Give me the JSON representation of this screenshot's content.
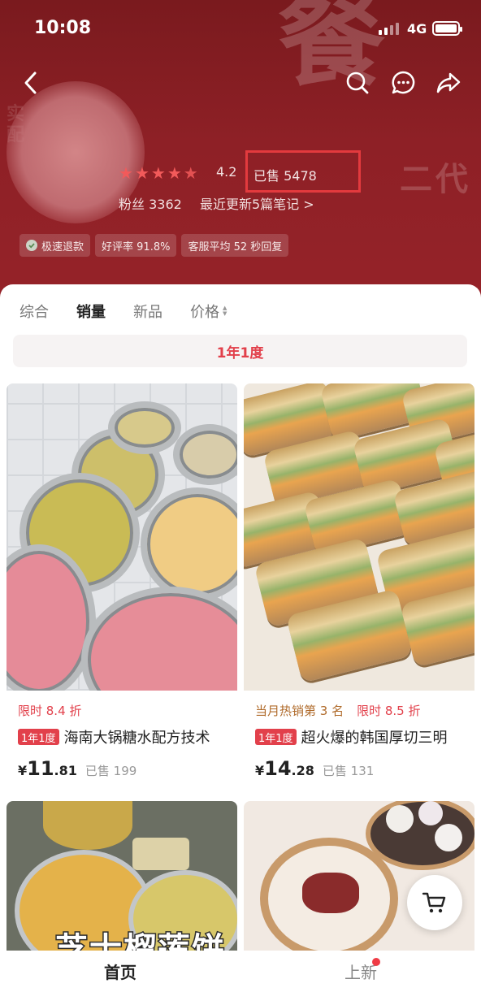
{
  "status_bar": {
    "time": "10:08",
    "network": "4G"
  },
  "header": {
    "bg_big_char": "餐",
    "bg_side_text": "二代",
    "bg_left_text": "实\n配",
    "rating": "4.2",
    "sold_total": "已售 5478",
    "fans": "粉丝 3362",
    "update": "最近更新5篇笔记 >",
    "tags": [
      "极速退款",
      "好评率 91.8%",
      "客服平均 52 秒回复"
    ]
  },
  "sort_tabs": [
    "综合",
    "销量",
    "新品",
    "价格"
  ],
  "filter_label": "1年1度",
  "products": [
    {
      "promo": "限时 8.4 折",
      "hot": "",
      "badge": "1年1度",
      "title": "海南大锅糖水配方技术",
      "price_currency": "¥",
      "price_int": "11",
      "price_dec": ".81",
      "sold": "已售 199"
    },
    {
      "promo": "限时 8.5 折",
      "hot": "当月热销第 3 名",
      "badge": "1年1度",
      "title": "超火爆的韩国厚切三明",
      "price_currency": "¥",
      "price_int": "14",
      "price_dec": ".28",
      "sold": "已售 131"
    }
  ],
  "image_texts": {
    "durian": "芝士榴莲饼"
  },
  "bottom_nav": {
    "home": "首页",
    "new": "上新"
  },
  "colors": {
    "accent": "#e2404b",
    "header_bg": "#8e2026",
    "highlight_box": "#e33a3e"
  }
}
